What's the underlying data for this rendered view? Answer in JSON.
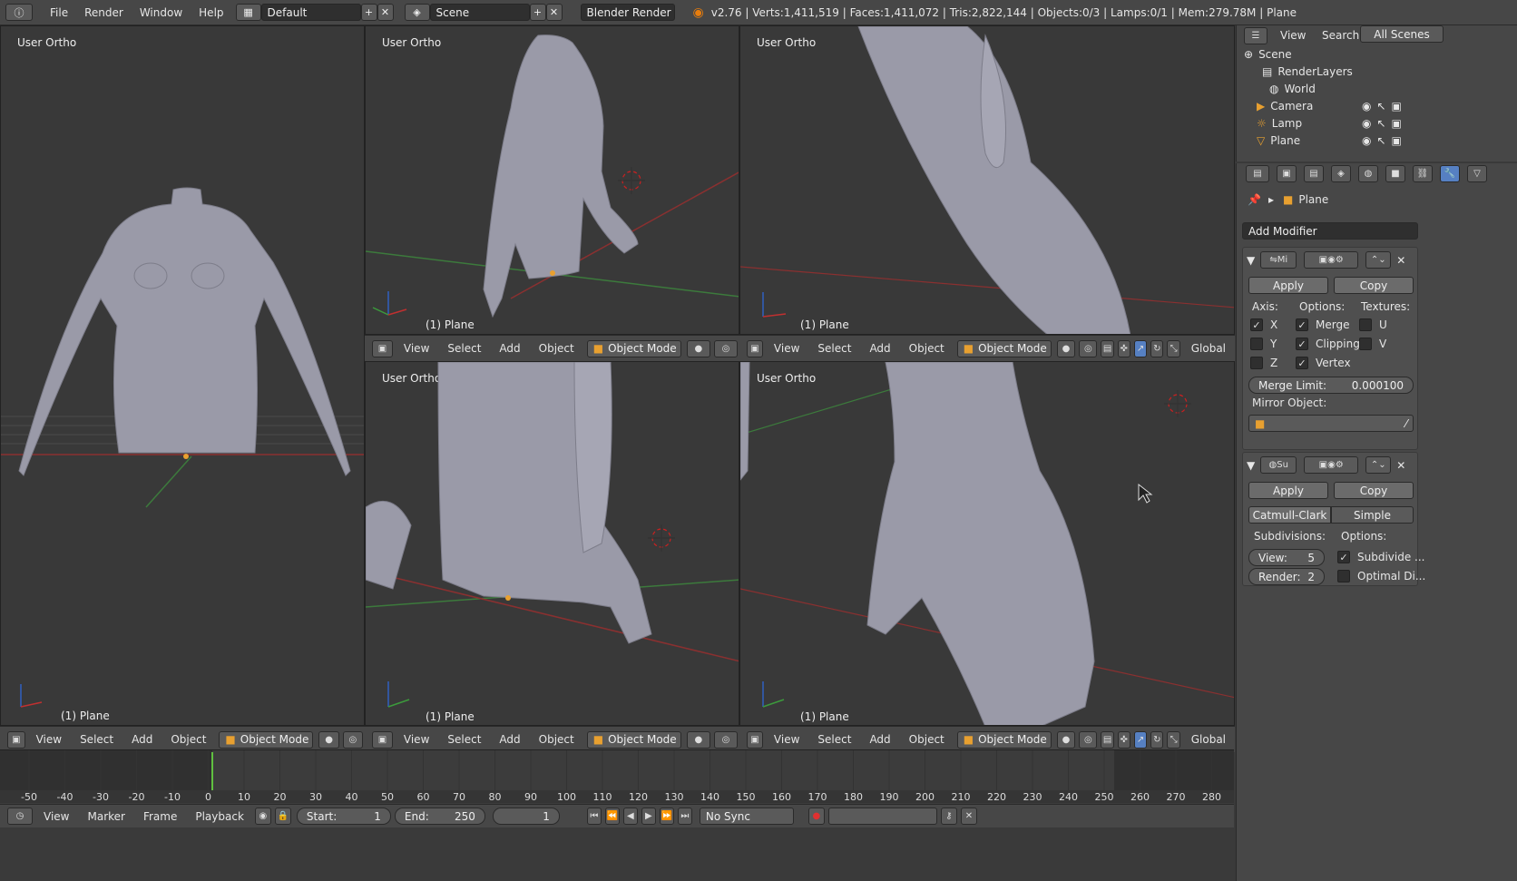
{
  "topbar": {
    "menus": [
      "File",
      "Render",
      "Window",
      "Help"
    ],
    "layout": "Default",
    "scene": "Scene",
    "engine": "Blender Render",
    "stats": "v2.76 | Verts:1,411,519 | Faces:1,411,072 | Tris:2,822,144 | Objects:0/3 | Lamps:0/1 | Mem:279.78M | Plane"
  },
  "viewports": [
    {
      "label": "User Ortho",
      "object": "(1) Plane"
    },
    {
      "label": "User Ortho",
      "object": "(1) Plane"
    },
    {
      "label": "User Ortho",
      "object": "(1) Plane"
    },
    {
      "label": "User Ortho",
      "object": "(1) Plane"
    },
    {
      "label": "User Ortho",
      "object": "(1) Plane"
    }
  ],
  "view_header": {
    "menus": [
      "View",
      "Select",
      "Add",
      "Object"
    ],
    "mode": "Object Mode",
    "orientation": "Global"
  },
  "outliner": {
    "menus": [
      "View",
      "Search",
      "All Scenes"
    ],
    "items": [
      "Scene",
      "RenderLayers",
      "World",
      "Camera",
      "Lamp",
      "Plane"
    ]
  },
  "properties": {
    "object": "Plane",
    "add_modifier": "Add Modifier",
    "mirror": {
      "name": "Mi",
      "apply": "Apply",
      "copy": "Copy",
      "axis_label": "Axis:",
      "options_label": "Options:",
      "textures_label": "Textures:",
      "axes": [
        "X",
        "Y",
        "Z"
      ],
      "options": [
        "Merge",
        "Clipping",
        "Vertex"
      ],
      "textures": [
        "U",
        "V"
      ],
      "merge_limit_label": "Merge Limit:",
      "merge_limit": "0.000100",
      "mirror_object_label": "Mirror Object:"
    },
    "subsurf": {
      "name": "Su",
      "apply": "Apply",
      "copy": "Copy",
      "tab_catmull": "Catmull-Clark",
      "tab_simple": "Simple",
      "subdivisions_label": "Subdivisions:",
      "options_label": "Options:",
      "view_label": "View:",
      "view": "5",
      "render_label": "Render:",
      "render": "2",
      "opt1": "Subdivide ...",
      "opt2": "Optimal Di..."
    }
  },
  "timeline": {
    "ticks": [
      "-50",
      "-40",
      "-30",
      "-20",
      "-10",
      "0",
      "10",
      "20",
      "30",
      "40",
      "50",
      "60",
      "70",
      "80",
      "90",
      "100",
      "110",
      "120",
      "130",
      "140",
      "150",
      "160",
      "170",
      "180",
      "190",
      "200",
      "210",
      "220",
      "230",
      "240",
      "250",
      "260",
      "270",
      "280"
    ],
    "menus": [
      "View",
      "Marker",
      "Frame",
      "Playback"
    ],
    "start_label": "Start:",
    "start": "1",
    "end_label": "End:",
    "end": "250",
    "current": "1",
    "sync": "No Sync"
  },
  "colors": {
    "accent": "#5680c2",
    "bg": "#393939",
    "header": "#474747"
  }
}
